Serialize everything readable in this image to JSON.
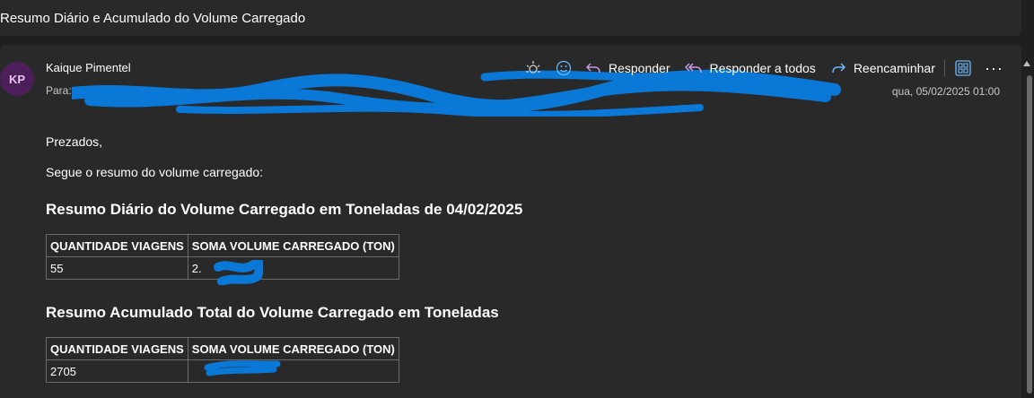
{
  "subject": "Resumo Diário e Acumulado do Volume Carregado",
  "message": {
    "avatar_initials": "KP",
    "sender": "Kaique Pimentel",
    "to_label": "Para:",
    "date": "qua, 05/02/2025 01:00"
  },
  "toolbar": {
    "reply": "Responder",
    "reply_all": "Responder a todos",
    "forward": "Reencaminhar",
    "more": "···"
  },
  "body": {
    "greeting": "Prezados,",
    "intro": "Segue o resumo do volume carregado:",
    "daily_title": "Resumo Diário do Volume Carregado em Toneladas de 04/02/2025",
    "daily_table": {
      "headers": [
        "QUANTIDADE VIAGENS",
        "SOMA VOLUME CARREGADO (TON)"
      ],
      "row": [
        "55",
        "2."
      ]
    },
    "total_title": "Resumo Acumulado Total do Volume Carregado em Toneladas",
    "total_table": {
      "headers": [
        "QUANTIDADE VIAGENS",
        "SOMA VOLUME CARREGADO (TON)"
      ],
      "row": [
        "2705",
        ""
      ]
    }
  },
  "colors": {
    "background": "#1f1f1f",
    "panel": "#292929",
    "avatar": "#4c1f5b",
    "reply_arrows": "#c79be0",
    "forward_arrow": "#6cb8f6",
    "redaction": "#0a78d7"
  }
}
